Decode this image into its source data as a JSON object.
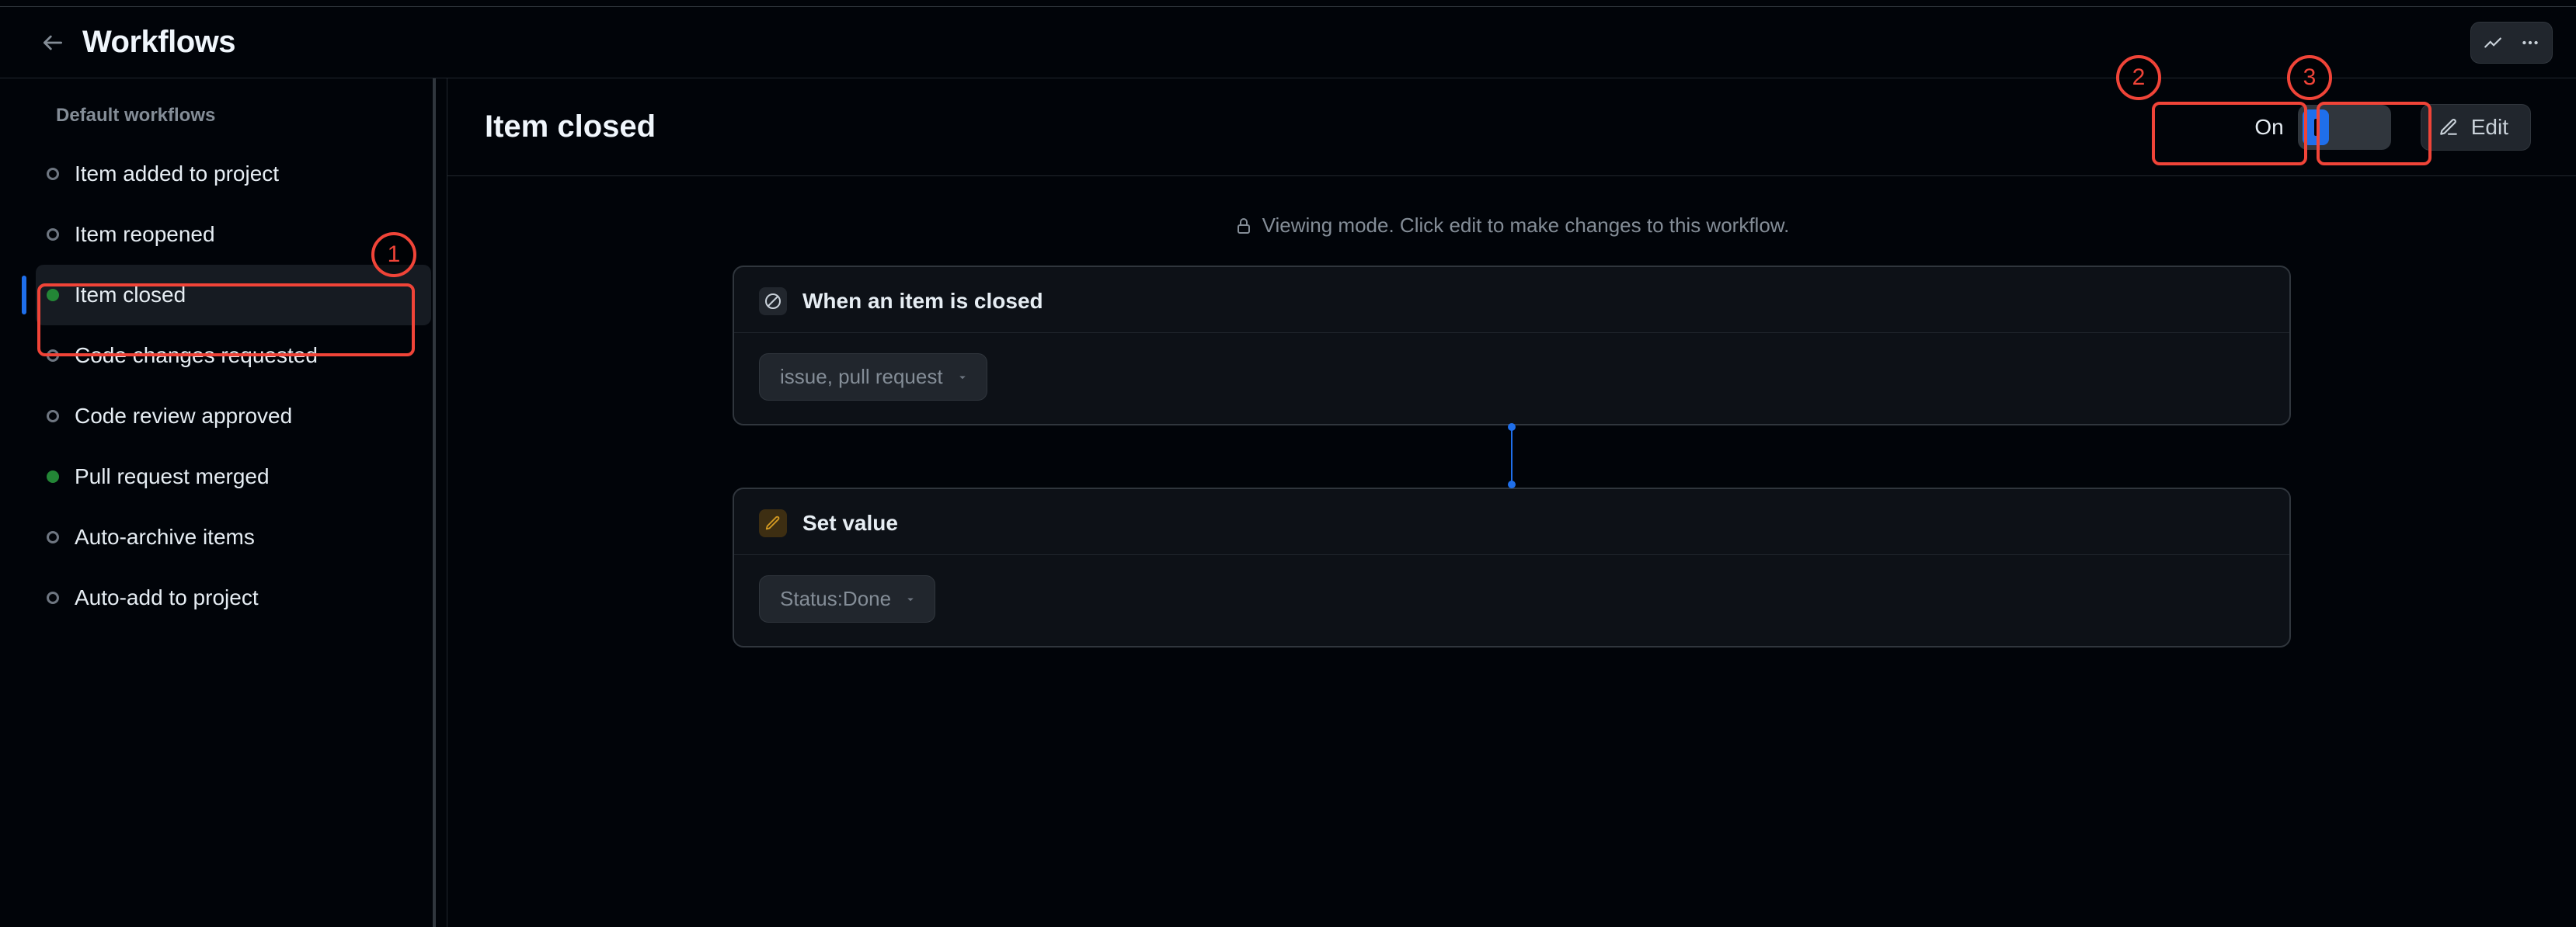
{
  "header": {
    "title": "Workflows"
  },
  "sidebar": {
    "heading": "Default workflows",
    "items": [
      {
        "label": "Item added to project",
        "enabled": false
      },
      {
        "label": "Item reopened",
        "enabled": false
      },
      {
        "label": "Item closed",
        "enabled": true
      },
      {
        "label": "Code changes requested",
        "enabled": false
      },
      {
        "label": "Code review approved",
        "enabled": false
      },
      {
        "label": "Pull request merged",
        "enabled": true
      },
      {
        "label": "Auto-archive items",
        "enabled": false
      },
      {
        "label": "Auto-add to project",
        "enabled": false
      }
    ],
    "active_index": 2
  },
  "main": {
    "title": "Item closed",
    "enabled_label": "On",
    "edit_label": "Edit",
    "viewing_notice": "Viewing mode. Click edit to make changes to this workflow.",
    "trigger": {
      "heading": "When an item is closed",
      "filter_chip": "issue, pull request"
    },
    "action": {
      "heading": "Set value",
      "value_chip": "Status:Done"
    }
  },
  "annotations": [
    {
      "n": "1"
    },
    {
      "n": "2"
    },
    {
      "n": "3"
    }
  ]
}
